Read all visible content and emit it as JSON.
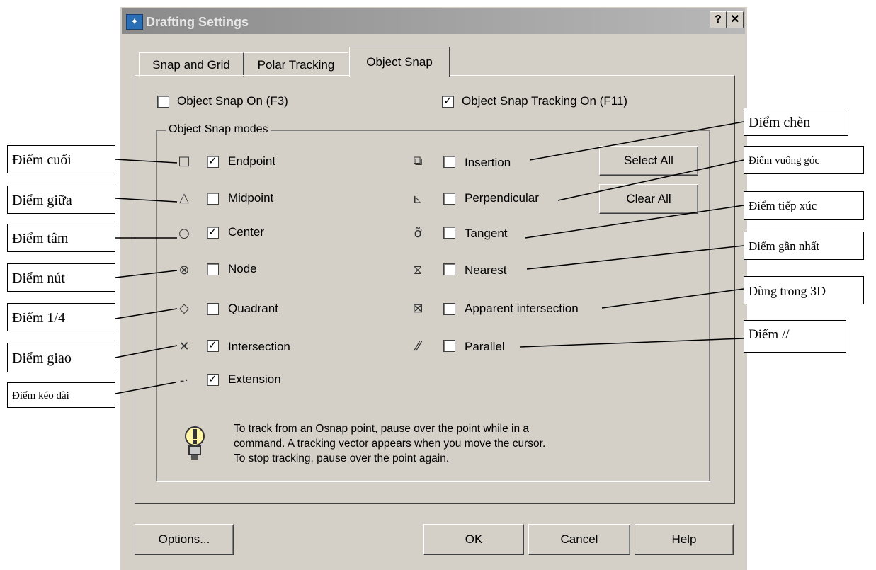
{
  "window": {
    "title": "Drafting Settings",
    "help_btn": "?",
    "close_btn": "✕"
  },
  "tabs": [
    {
      "label": "Snap and Grid",
      "active": false
    },
    {
      "label": "Polar Tracking",
      "active": false
    },
    {
      "label": "Object Snap",
      "active": true
    }
  ],
  "top_options": {
    "snap_on": {
      "label": "Object Snap On (F3)",
      "checked": false
    },
    "tracking_on": {
      "label": "Object Snap Tracking On (F11)",
      "checked": true
    }
  },
  "modes": {
    "group_label": "Object Snap modes",
    "left": [
      {
        "symbol": "□",
        "label": "Endpoint",
        "checked": true
      },
      {
        "symbol": "△",
        "label": "Midpoint",
        "checked": false
      },
      {
        "symbol": "○",
        "label": "Center",
        "checked": true
      },
      {
        "symbol": "⊗",
        "label": "Node",
        "checked": false
      },
      {
        "symbol": "◇",
        "label": "Quadrant",
        "checked": false
      },
      {
        "symbol": "✕",
        "label": "Intersection",
        "checked": true
      },
      {
        "symbol": "-·",
        "label": "Extension",
        "checked": true
      }
    ],
    "right": [
      {
        "symbol": "⧉",
        "label": "Insertion",
        "checked": false
      },
      {
        "symbol": "⊾",
        "label": "Perpendicular",
        "checked": false
      },
      {
        "symbol": "ỡ",
        "label": "Tangent",
        "checked": false
      },
      {
        "symbol": "⧖",
        "label": "Nearest",
        "checked": false
      },
      {
        "symbol": "⊠",
        "label": "Apparent intersection",
        "checked": false
      },
      {
        "symbol": "⁄⁄",
        "label": "Parallel",
        "checked": false
      }
    ],
    "select_all": "Select All",
    "clear_all": "Clear All"
  },
  "tip": {
    "line1": "To track from an Osnap point, pause over the point while in a",
    "line2": "command.  A tracking vector appears when you move the cursor.",
    "line3": "To stop tracking, pause over the point again."
  },
  "footer": {
    "options": "Options...",
    "ok": "OK",
    "cancel": "Cancel",
    "help": "Help"
  },
  "annotations_left": [
    "Điểm cuối",
    "Điểm giữa",
    "Điểm tâm",
    "Điểm nút",
    "Điểm 1/4",
    "Điểm giao",
    "Điểm kéo dài"
  ],
  "annotations_right": [
    "Điểm chèn",
    "Điểm vuông góc",
    "Điểm tiếp xúc",
    "Điểm gần nhất",
    "Dùng trong 3D",
    "Điểm //"
  ]
}
